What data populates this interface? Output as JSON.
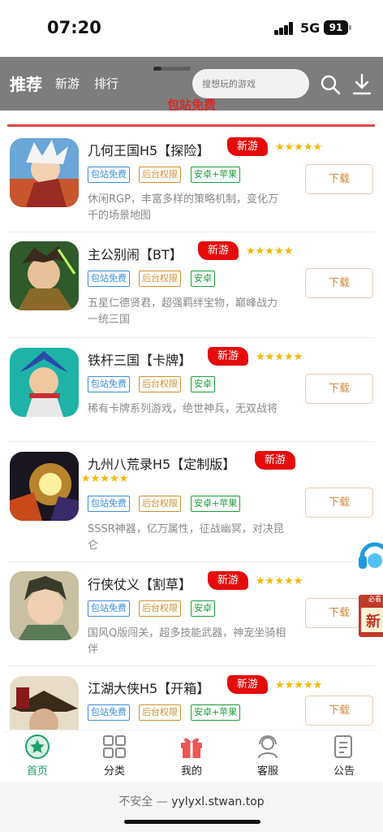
{
  "status_bar": {
    "time": "07:20",
    "network": "5G",
    "battery": "91"
  },
  "nav": {
    "tab_recommend": "推荐",
    "tab_new": "新游",
    "tab_rank": "排行",
    "search_placeholder": "搜想玩的游戏",
    "banner": "包站免费"
  },
  "games": [
    {
      "name": "几何王国H5【探险】",
      "badge": "新游",
      "stars": "★★★★★",
      "tags": [
        "包站免费",
        "后台权限",
        "安卓+苹果"
      ],
      "desc": "休闲RGP，丰富多样的策略机制，变化万千的场景地图",
      "button": "下载"
    },
    {
      "name": "主公别闹【BT】",
      "badge": "新游",
      "stars": "★★★★★",
      "tags": [
        "包站免费",
        "后台权限",
        "安卓"
      ],
      "desc": "五星仁德贤君，超强羁绊宝物，巅峰战力一统三国",
      "button": "下载"
    },
    {
      "name": "铁杆三国【卡牌】",
      "badge": "新游",
      "stars": "★★★★★",
      "tags": [
        "包站免费",
        "后台权限",
        "安卓"
      ],
      "desc": "稀有卡牌系列游戏，绝世神兵，无双战将",
      "button": "下载"
    },
    {
      "name": "九州八荒录H5【定制版】",
      "badge": "新游",
      "stars": "★★★★★",
      "tags": [
        "包站免费",
        "后台权限",
        "安卓+苹果"
      ],
      "desc": "SSSR神器，亿万属性，征战幽冥，对决昆仑",
      "button": "下载"
    },
    {
      "name": "行侠仗义【割草】",
      "badge": "新游",
      "stars": "★★★★★",
      "tags": [
        "包站免费",
        "后台权限",
        "安卓"
      ],
      "desc": "国风Q版闯关，超多技能武器，神宠坐骑相伴",
      "button": "下载"
    },
    {
      "name": "江湖大侠H5【开箱】",
      "badge": "新游",
      "stars": "★★★★★",
      "tags": [
        "包站免费",
        "后台权限",
        "安卓+苹果"
      ],
      "desc": "",
      "button": "下载"
    }
  ],
  "float_gift_text": "必看",
  "tabbar": {
    "home": "首页",
    "category": "分类",
    "mine": "我的",
    "service": "客服",
    "notice": "公告"
  },
  "browser": {
    "insecure": "不安全 — ",
    "url": "yylyxl.stwan.top"
  },
  "colors": {
    "accent_red": "#e50b0b",
    "active_green": "#20a06a",
    "download_orange": "#d08a3c"
  }
}
